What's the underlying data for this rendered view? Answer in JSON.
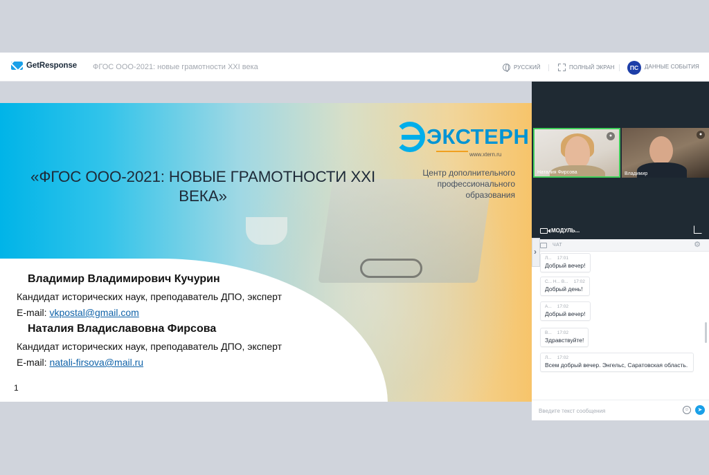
{
  "topbar": {
    "logo_text": "GetResponse",
    "event_title": "ФГОС ООО-2021: новые грамотности XXI века",
    "language_label": "РУССКИЙ",
    "fullscreen_label": "ПОЛНЫЙ ЭКРАН",
    "avatar_initials": "ПС",
    "event_data_label": "ДАННЫЕ СОБЫТИЯ"
  },
  "slide": {
    "title": "«ФГОС ООО-2021: НОВЫЕ ГРАМОТНОСТИ XXI ВЕКА»",
    "brand_name": "ЭКСТЕРН",
    "brand_url": "www.xtern.ru",
    "center_text": "Центр дополнительного профессионального образования",
    "author1_name": "Владимир Владимирович Кучурин",
    "author1_desc": "Кандидат исторических наук, преподаватель ДПО, эксперт",
    "author1_email_prefix": "E-mail: ",
    "author1_email": "vkpostal@gmail.com",
    "author2_name": "Наталия Владиславовна Фирсова",
    "author2_desc": "Кандидат исторических наук, преподаватель ДПО, эксперт",
    "author2_email_prefix": "E-mail: ",
    "author2_email": "natali-firsova@mail.ru",
    "page_number": "1"
  },
  "videos": [
    {
      "name": "Наталия Фирсова"
    },
    {
      "name": "Владимир"
    }
  ],
  "module_label": "МОДУЛЬ...",
  "chat": {
    "label": "ЧАТ",
    "messages": [
      {
        "author": "Л...",
        "time": "17:01",
        "text": "Добрый вечер!"
      },
      {
        "author": "С... Н... В...",
        "time": "17:02",
        "text": "Добрый день!"
      },
      {
        "author": "А...",
        "time": "17:02",
        "text": "Добрый вечер!"
      },
      {
        "author": "В...",
        "time": "17:02",
        "text": "Здравствуйте!"
      },
      {
        "author": "Л...",
        "time": "17:02",
        "text": "Всем добрый вечер. Энгельс, Саратовская область."
      }
    ],
    "input_placeholder": "Введите текст сообщения"
  },
  "colors": {
    "accent": "#1aa0e8",
    "brand_blue": "#0094d4",
    "avatar": "#1d3ea8",
    "panel_dark": "#1f2a33",
    "active_speaker": "#3fcf5a"
  }
}
